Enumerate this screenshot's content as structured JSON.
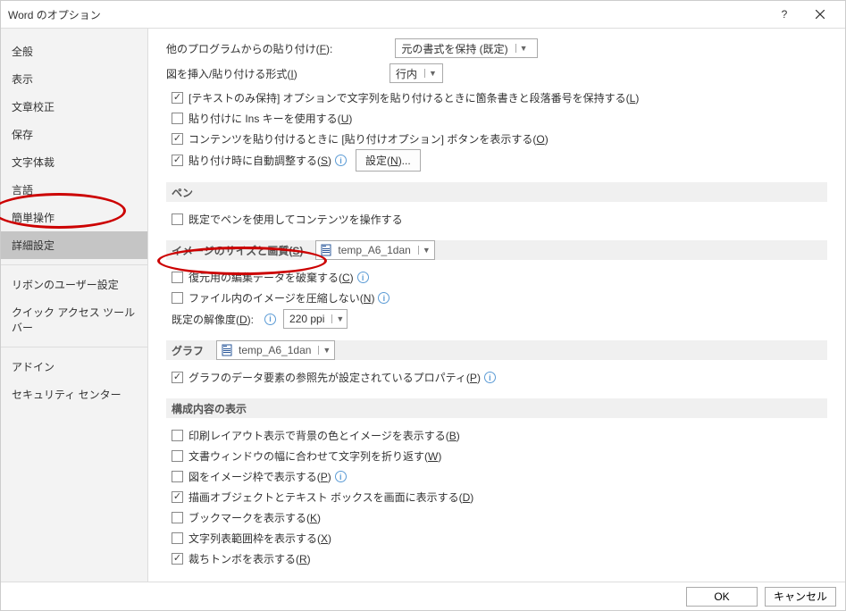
{
  "titlebar": {
    "title": "Word のオプション",
    "help": "?",
    "close": "×"
  },
  "sidebar": {
    "items": [
      "全般",
      "表示",
      "文章校正",
      "保存",
      "文字体裁",
      "言語",
      "簡単操作",
      "詳細設定",
      "リボンのユーザー設定",
      "クイック アクセス ツール バー",
      "アドイン",
      "セキュリティ センター"
    ],
    "selectedIndex": 7
  },
  "paste_section": {
    "other_program_label_pre": "他のプログラムからの貼り付け(",
    "other_program_key": "F",
    "other_program_label_post": "):",
    "other_program_value": "元の書式を保持 (既定)",
    "insert_paste_label_pre": "図を挿入/貼り付ける形式(",
    "insert_paste_key": "I",
    "insert_paste_label_post": ")",
    "insert_paste_value": "行内",
    "opt1_pre": "[テキストのみ保持] オプションで文字列を貼り付けるときに箇条書きと段落番号を保持する(",
    "opt1_key": "L",
    "opt1_post": ")",
    "opt2_pre": "貼り付けに Ins キーを使用する(",
    "opt2_key": "U",
    "opt2_post": ")",
    "opt3_pre": "コンテンツを貼り付けるときに [貼り付けオプション] ボタンを表示する(",
    "opt3_key": "O",
    "opt3_post": ")",
    "opt4_pre": "貼り付け時に自動調整する(",
    "opt4_key": "S",
    "opt4_post": ")",
    "settings_btn_pre": "設定(",
    "settings_btn_key": "N",
    "settings_btn_post": ")..."
  },
  "pen_section": {
    "title": "ペン",
    "opt1": "既定でペンを使用してコンテンツを操作する"
  },
  "image_section": {
    "title_pre": "イメージのサイズと画質(",
    "title_key": "S",
    "title_post": ")",
    "doc_value": "temp_A6_1dan",
    "opt1_pre": "復元用の編集データを破棄する(",
    "opt1_key": "C",
    "opt1_post": ")",
    "opt2_pre": "ファイル内のイメージを圧縮しない(",
    "opt2_key": "N",
    "opt2_post": ")",
    "default_res_pre": "既定の解像度(",
    "default_res_key": "D",
    "default_res_post": "):",
    "default_res_value": "220 ppi"
  },
  "graph_section": {
    "title": "グラフ",
    "doc_value": "temp_A6_1dan",
    "opt1_pre": "グラフのデータ要素の参照先が設定されているプロパティ(",
    "opt1_key": "P",
    "opt1_post": ")"
  },
  "display_section": {
    "title": "構成内容の表示",
    "opt1_pre": "印刷レイアウト表示で背景の色とイメージを表示する(",
    "opt1_key": "B",
    "opt1_post": ")",
    "opt2_pre": "文書ウィンドウの幅に合わせて文字列を折り返す(",
    "opt2_key": "W",
    "opt2_post": ")",
    "opt3_pre": "図をイメージ枠で表示する(",
    "opt3_key": "P",
    "opt3_post": ")",
    "opt4_pre": "描画オブジェクトとテキスト ボックスを画面に表示する(",
    "opt4_key": "D",
    "opt4_post": ")",
    "opt5_pre": "ブックマークを表示する(",
    "opt5_key": "K",
    "opt5_post": ")",
    "opt6_pre": "文字列表範囲枠を表示する(",
    "opt6_key": "X",
    "opt6_post": ")",
    "opt7_pre": "裁ちトンボを表示する(",
    "opt7_key": "R",
    "opt7_post": ")"
  },
  "footer": {
    "ok": "OK",
    "cancel": "キャンセル"
  }
}
